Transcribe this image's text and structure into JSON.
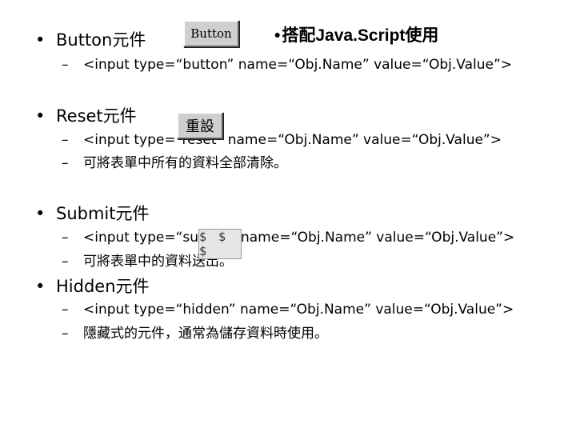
{
  "sections": {
    "button": {
      "title": "Button元件",
      "code": "<input type=“button” name=“Obj.Name” value=“Obj.Value”>",
      "image_label": "Button",
      "note": "搭配Java.Script使用"
    },
    "reset": {
      "title": "Reset元件",
      "code": "<input type=“reset” name=“Obj.Name” value=“Obj.Value”>",
      "desc": "可將表單中所有的資料全部清除。",
      "image_label": "重設"
    },
    "submit": {
      "title": "Submit元件",
      "code": "<input type=“submit” name=“Obj.Name” value=“Obj.Value”>",
      "desc": "可將表單中的資料送出。",
      "image_label": "$ $ $"
    },
    "hidden": {
      "title": "Hidden元件",
      "code": "<input type=“hidden” name=“Obj.Name” value=“Obj.Value”>",
      "desc": "隱藏式的元件，通常為儲存資料時使用。"
    }
  }
}
